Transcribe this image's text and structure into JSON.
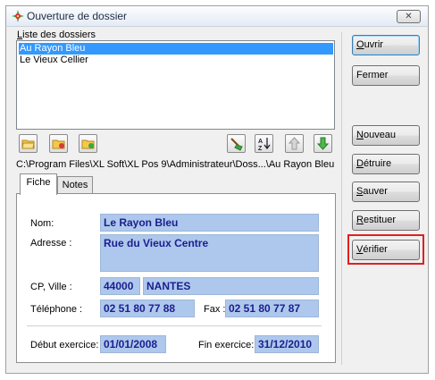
{
  "window": {
    "title": "Ouverture de dossier",
    "close_glyph": "✕"
  },
  "list": {
    "label_mnemonic": "L",
    "label_rest": "iste des dossiers",
    "items": [
      "Au Rayon Bleu",
      "Le Vieux Cellier"
    ],
    "selected_index": 0
  },
  "toolbar_icons": [
    "folder-open-icon",
    "folder-red-icon",
    "folder-green-icon",
    "broom-icon",
    "sort-az-icon",
    "arrow-up-icon",
    "arrow-down-icon"
  ],
  "path": "C:\\Program Files\\XL Soft\\XL Pos 9\\Administrateur\\Doss...\\Au Rayon Bleu",
  "tabs": [
    "Fiche",
    "Notes"
  ],
  "form": {
    "nom_label": "Nom:",
    "nom_value": "Le Rayon Bleu",
    "adresse_label": "Adresse :",
    "adresse_value": "Rue du Vieux Centre",
    "cp_ville_label": "CP, Ville :",
    "cp_value": "44000",
    "ville_value": "NANTES",
    "telephone_label": "Téléphone :",
    "telephone_value": "02 51 80 77 88",
    "fax_label": "Fax :",
    "fax_value": "02 51 80 77 87",
    "debut_label": "Début exercice:",
    "debut_value": "01/01/2008",
    "fin_label": "Fin exercice:",
    "fin_value": "31/12/2010"
  },
  "buttons": {
    "ouvrir": {
      "mn": "O",
      "rest": "uvrir"
    },
    "fermer": {
      "mn": "",
      "rest": "Fermer"
    },
    "nouveau": {
      "mn": "N",
      "rest": "ouveau"
    },
    "detruire": {
      "mn": "D",
      "rest": "étruire"
    },
    "sauver": {
      "mn": "S",
      "rest": "auver"
    },
    "restituer": {
      "mn": "R",
      "rest": "estituer"
    },
    "verifier": {
      "mn": "V",
      "rest": "érifier"
    }
  },
  "colors": {
    "selection": "#3399ff",
    "field_bg": "#adc8ec",
    "field_text": "#1d1d8f",
    "highlight": "#e02020"
  }
}
